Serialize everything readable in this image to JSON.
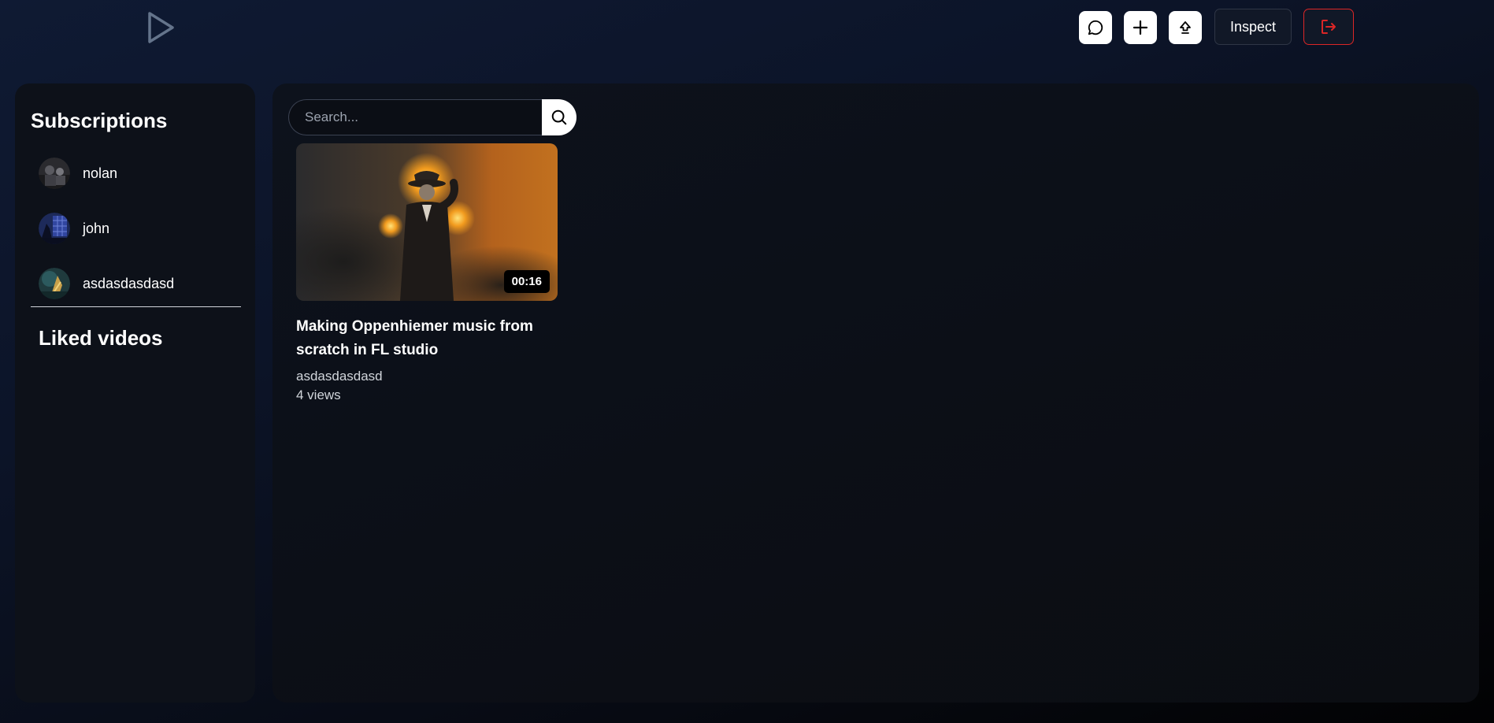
{
  "header": {
    "inspect_label": "Inspect",
    "icons": [
      "play-logo-icon",
      "chat-icon",
      "plus-icon",
      "upload-icon",
      "logout-icon"
    ]
  },
  "sidebar": {
    "title": "Subscriptions",
    "subscriptions": [
      {
        "name": "nolan"
      },
      {
        "name": "john"
      },
      {
        "name": "asdasdasdasd"
      }
    ],
    "liked_title": "Liked videos"
  },
  "search": {
    "placeholder": "Search..."
  },
  "videos": [
    {
      "title": "Making Oppenhiemer music from scratch in FL studio",
      "channel": "asdasdasdasd",
      "views": "4 views",
      "duration": "00:16"
    }
  ],
  "colors": {
    "logo": "#64748b",
    "logout": "#dc2626",
    "panel": "#0d1119"
  }
}
